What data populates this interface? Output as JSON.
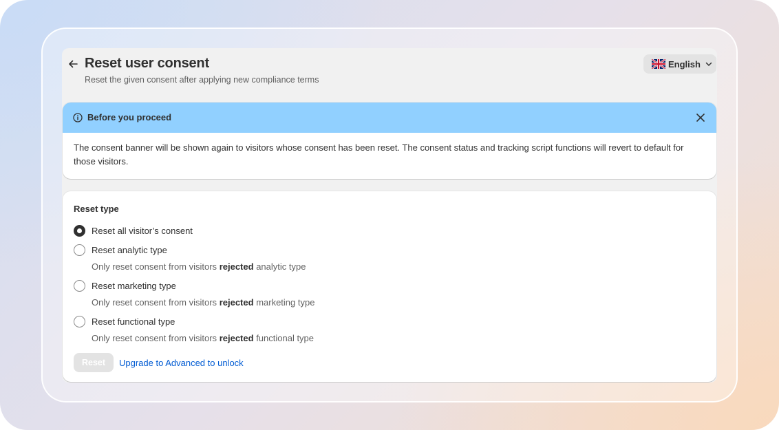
{
  "header": {
    "back_icon": "arrow-left-icon",
    "title": "Reset user consent",
    "subtitle": "Reset the given consent after applying new compliance terms",
    "language": {
      "flag_icon": "uk-flag-icon",
      "label": "English",
      "chevron_icon": "chevron-down-icon"
    }
  },
  "banner": {
    "icon": "info-icon",
    "title": "Before you proceed",
    "close_icon": "close-icon",
    "body": "The consent banner will be shown again to visitors whose consent has been reset. The consent status and tracking script functions will revert to default for those visitors.",
    "background_color": "#91d0ff"
  },
  "reset_type": {
    "title": "Reset type",
    "options": [
      {
        "label": "Reset all visitor’s consent",
        "checked": true
      },
      {
        "label": "Reset analytic type",
        "checked": false,
        "help_prefix": "Only reset consent from visitors",
        "help_bold": "rejected",
        "help_suffix": "analytic type"
      },
      {
        "label": "Reset marketing type",
        "checked": false,
        "help_prefix": "Only reset consent from visitors",
        "help_bold": "rejected",
        "help_suffix": "marketing type"
      },
      {
        "label": "Reset functional type",
        "checked": false,
        "help_prefix": "Only reset consent from visitors",
        "help_bold": "rejected",
        "help_suffix": "functional type"
      }
    ],
    "reset_button": "Reset",
    "reset_disabled": true,
    "upgrade_link": "Upgrade to Advanced to unlock",
    "link_color": "#005bd3"
  }
}
